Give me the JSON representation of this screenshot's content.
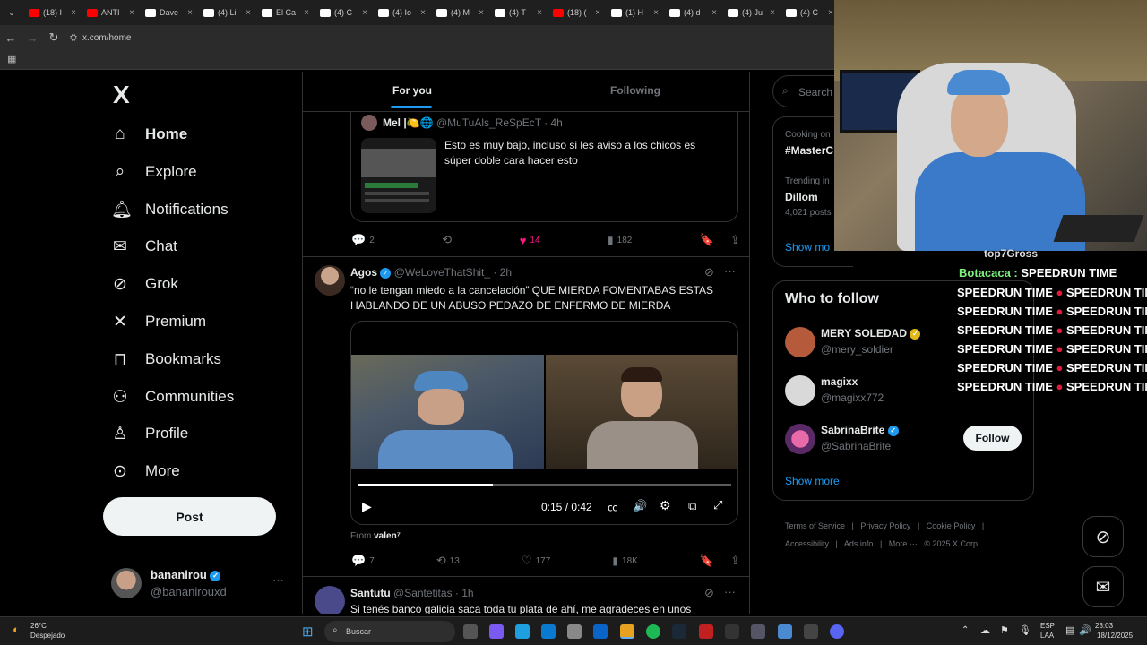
{
  "browser": {
    "tabs": [
      {
        "label": "(18) I",
        "color": "#ff0000"
      },
      {
        "label": "ANTI",
        "color": "#ff0000"
      },
      {
        "label": "Dave",
        "color": "#ffffff"
      },
      {
        "label": "(4) Li",
        "color": "#ffffff"
      },
      {
        "label": "El Ca",
        "color": "#ffffff"
      },
      {
        "label": "(4) C",
        "color": "#ffffff"
      },
      {
        "label": "(4) Io",
        "color": "#ffffff"
      },
      {
        "label": "(4) M",
        "color": "#ffffff"
      },
      {
        "label": "(4) T",
        "color": "#ffffff"
      },
      {
        "label": "(18) (",
        "color": "#ff0000"
      },
      {
        "label": "(1) H",
        "color": "#ffffff"
      },
      {
        "label": "(4) d",
        "color": "#ffffff"
      },
      {
        "label": "(4) Ju",
        "color": "#ffffff"
      },
      {
        "label": "(4) C",
        "color": "#ffffff"
      }
    ],
    "url": "x.com/home"
  },
  "leftnav": {
    "logo": "X",
    "items": [
      {
        "label": "Home",
        "icon": "home-icon"
      },
      {
        "label": "Explore",
        "icon": "search-icon"
      },
      {
        "label": "Notifications",
        "icon": "bell-icon"
      },
      {
        "label": "Chat",
        "icon": "mail-icon"
      },
      {
        "label": "Grok",
        "icon": "grok-icon"
      },
      {
        "label": "Premium",
        "icon": "x-icon"
      },
      {
        "label": "Bookmarks",
        "icon": "bookmark-icon"
      },
      {
        "label": "Communities",
        "icon": "people-icon"
      },
      {
        "label": "Profile",
        "icon": "person-icon"
      },
      {
        "label": "More",
        "icon": "more-icon"
      }
    ],
    "post_label": "Post",
    "account": {
      "name": "bananirou",
      "handle": "@bananirouxd",
      "more": "···"
    }
  },
  "feed": {
    "tabs": {
      "for_you": "For you",
      "following": "Following"
    },
    "quoted": {
      "name": "Mel |🍋🌐",
      "handle": "@MuTuAls_ReSpEcT",
      "time": "· 4h",
      "text": "Esto es muy bajo, incluso si les aviso a los chicos es súper doble cara hacer esto"
    },
    "quoted_actions": {
      "replies": "2",
      "likes": "14",
      "views": "182"
    },
    "tweet2": {
      "name": "Agos",
      "handle": "@WeLoveThatShit_",
      "time": "· 2h",
      "text": "“no le tengan miedo a la cancelación” QUE MIERDA FOMENTABAS ESTAS HABLANDO DE UN ABUSO PEDAZO DE ENFERMO DE MIERDA",
      "video_time": "0:15 / 0:42",
      "video_progress": 0.36,
      "from_label": "From",
      "from_user": "valen⁷",
      "replies": "7",
      "retweets": "13",
      "likes": "177",
      "views": "18K"
    },
    "tweet3": {
      "name": "Santutu",
      "handle": "@Santetitas",
      "time": "· 1h",
      "text": "Si tenés banco galicia saca toda tu plata de ahí, me agradeces en unos"
    }
  },
  "right": {
    "search_placeholder": "Search",
    "trends": [
      {
        "meta": "Cooking on",
        "title": "#MasterC"
      },
      {
        "meta": "Trending in",
        "title": "Dillom",
        "count": "4,021 posts"
      }
    ],
    "trends_show_more": "Show mo",
    "who_to_follow_title": "Who to follow",
    "suggestions": [
      {
        "name": "MERY SOLEDAD",
        "handle": "@mery_soldier",
        "badge": "gold"
      },
      {
        "name": "magixx",
        "handle": "@magixx772",
        "badge": ""
      },
      {
        "name": "SabrinaBrite",
        "handle": "@SabrinaBrite",
        "badge": "blue"
      }
    ],
    "follow_label": "Follow",
    "show_more": "Show more",
    "footer": [
      "Terms of Service",
      "|",
      "Privacy Policy",
      "|",
      "Cookie Policy",
      "|",
      "Accessibility",
      "|",
      "Ads info",
      "|",
      "More ···",
      "© 2025 X Corp."
    ]
  },
  "overlay_chat": {
    "top_line": "top7Gross",
    "user": "Botacaca :",
    "message": "SPEEDRUN TIME",
    "speedrun_time": "SPEEDRUN TIME"
  },
  "taskbar": {
    "weather_temp": "26°C",
    "weather_text": "Despejado",
    "search": "Buscar",
    "lang": "ESP",
    "lang2": "LAA",
    "time": "23:03",
    "date": "18/12/2025"
  }
}
